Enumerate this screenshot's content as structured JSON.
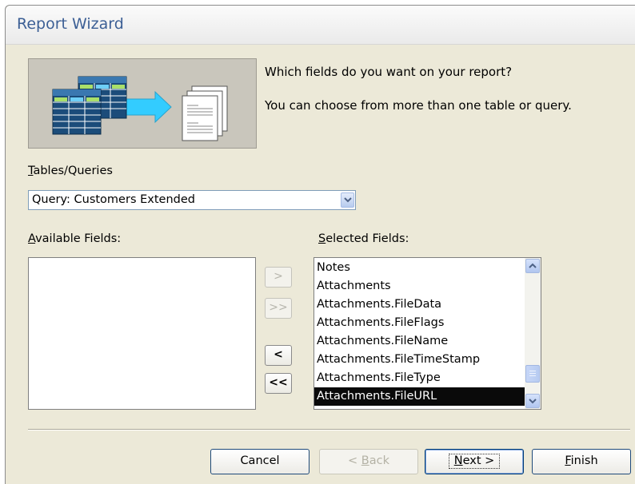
{
  "window": {
    "title": "Report Wizard"
  },
  "intro": {
    "question": "Which fields do you want on your report?",
    "hint": "You can choose from more than one table or query."
  },
  "tables_queries": {
    "label_mnemonic": "T",
    "label_rest": "ables/Queries",
    "selected": "Query: Customers Extended",
    "dropdown_icon": "chevron-down-icon"
  },
  "available_fields": {
    "label_mnemonic": "A",
    "label_rest": "vailable Fields:",
    "items": []
  },
  "selected_fields": {
    "label_mnemonic": "S",
    "label_rest": "elected Fields:",
    "items": [
      "Notes",
      "Attachments",
      "Attachments.FileData",
      "Attachments.FileFlags",
      "Attachments.FileName",
      "Attachments.FileTimeStamp",
      "Attachments.FileType",
      "Attachments.FileURL"
    ],
    "selected_item": "Attachments.FileURL"
  },
  "move_buttons": {
    "add_one": ">",
    "add_all": ">>",
    "remove_one": "<",
    "remove_all": "<<"
  },
  "footer": {
    "cancel": "Cancel",
    "back_prefix": "< ",
    "back_mnemonic": "B",
    "back_rest": "ack",
    "next_mnemonic": "N",
    "next_rest": "ext >",
    "finish_mnemonic": "F",
    "finish_rest": "inish"
  },
  "colors": {
    "title_text": "#3c5f95",
    "dialog_bg": "#ece9d8",
    "selection_bg": "#0a0a0a",
    "arrow_graphic": "#33ccff"
  }
}
